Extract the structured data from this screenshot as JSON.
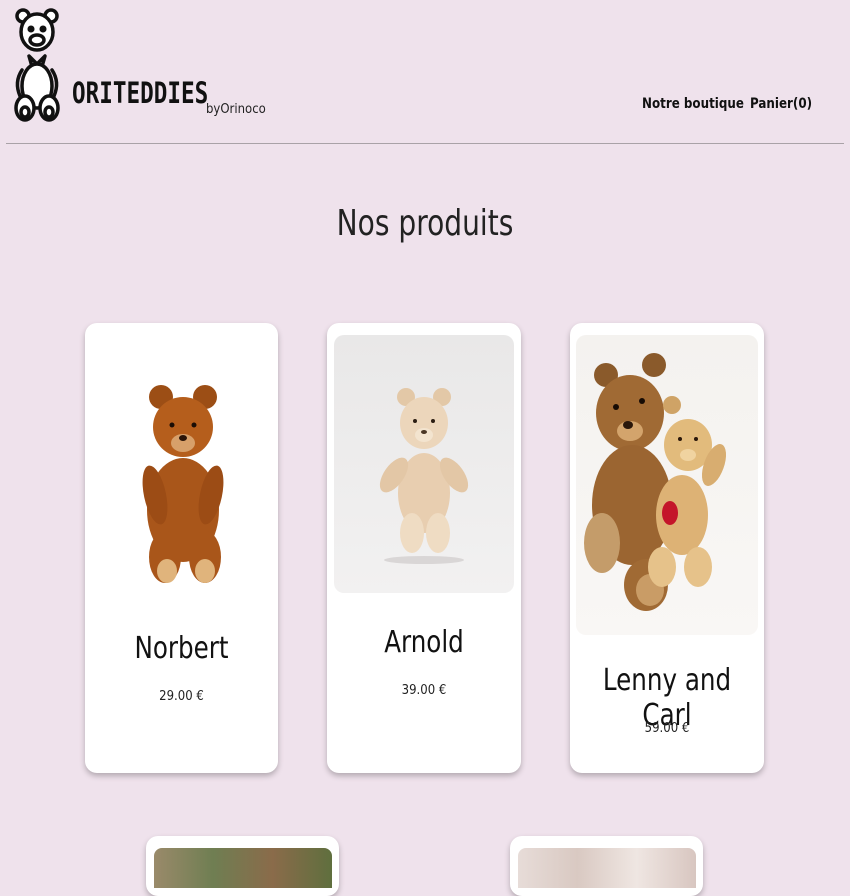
{
  "brand": {
    "name": "ORITEDDIES",
    "by": "byOrinoco"
  },
  "nav": {
    "shop": "Notre boutique",
    "cart": "Panier(0)"
  },
  "page": {
    "title": "Nos produits"
  },
  "products": [
    {
      "name": "Norbert",
      "price": "29.00 €"
    },
    {
      "name": "Arnold",
      "price": "39.00 €"
    },
    {
      "name": "Lenny and Carl",
      "price": "59.00 €"
    }
  ],
  "colors": {
    "background": "#efe2ec",
    "card": "#ffffff",
    "divider": "#a9a2a7"
  },
  "icons": {
    "logo": "teddy-bear-outline-icon"
  }
}
